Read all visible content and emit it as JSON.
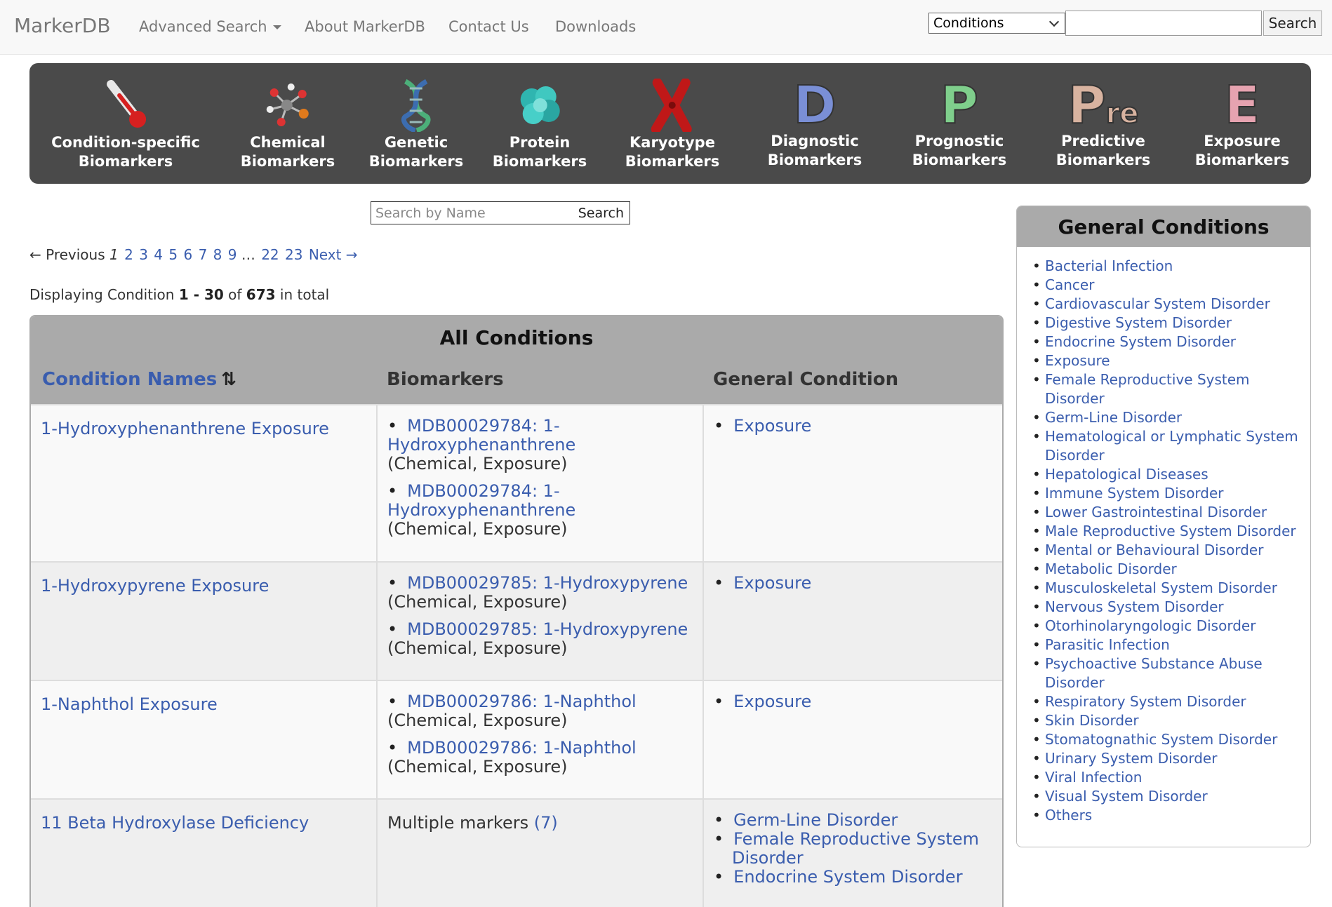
{
  "nav": {
    "brand": "MarkerDB",
    "items": [
      "Advanced Search",
      "About MarkerDB",
      "Contact Us",
      "Downloads"
    ],
    "select_value": "Conditions",
    "search_button": "Search"
  },
  "banner": {
    "categories": [
      {
        "line1": "Condition-specific",
        "line2": "Biomarkers",
        "icon": "thermometer-icon"
      },
      {
        "line1": "Chemical",
        "line2": "Biomarkers",
        "icon": "molecule-icon"
      },
      {
        "line1": "Genetic",
        "line2": "Biomarkers",
        "icon": "dna-icon"
      },
      {
        "line1": "Protein",
        "line2": "Biomarkers",
        "icon": "protein-icon"
      },
      {
        "line1": "Karyotype",
        "line2": "Biomarkers",
        "icon": "chromosome-icon"
      },
      {
        "line1": "Diagnostic",
        "line2": "Biomarkers",
        "icon": "letter-d-icon"
      },
      {
        "line1": "Prognostic",
        "line2": "Biomarkers",
        "icon": "letter-p-icon"
      },
      {
        "line1": "Predictive",
        "line2": "Biomarkers",
        "icon": "letter-pre-icon"
      },
      {
        "line1": "Exposure",
        "line2": "Biomarkers",
        "icon": "letter-e-icon"
      }
    ],
    "letters": {
      "d": "D",
      "p": "P",
      "pre_p": "P",
      "pre_re": "re",
      "e": "E"
    },
    "colors": {
      "d": "#7a8fd6",
      "p": "#7fcf8c",
      "pre": "#d8b3a0",
      "e": "#e6a3b0"
    }
  },
  "name_search": {
    "placeholder": "Search by Name",
    "button": "Search"
  },
  "pager": {
    "previous": "← Previous",
    "current": "1",
    "pages": [
      "2",
      "3",
      "4",
      "5",
      "6",
      "7",
      "8",
      "9"
    ],
    "ellipsis": "…",
    "last_pages": [
      "22",
      "23"
    ],
    "next": "Next →"
  },
  "display": {
    "prefix": "Displaying Condition",
    "range": "1 - 30",
    "of": "of",
    "total": "673",
    "suffix": "in total"
  },
  "table": {
    "title": "All Conditions",
    "headers": {
      "names": "Condition Names",
      "biomarkers": "Biomarkers",
      "general": "General Condition"
    },
    "rows": [
      {
        "name": "1-Hydroxyphenanthrene Exposure",
        "markers": [
          {
            "link1": "MDB00029784: 1-",
            "link2": "Hydroxyphenanthrene",
            "meta": "(Chemical, Exposure)"
          },
          {
            "link1": "MDB00029784: 1-",
            "link2": "Hydroxyphenanthrene",
            "meta": "(Chemical, Exposure)"
          }
        ],
        "general": [
          "Exposure"
        ]
      },
      {
        "name": "1-Hydroxypyrene Exposure",
        "markers": [
          {
            "link1": "MDB00029785: 1-Hydroxypyrene",
            "meta": "(Chemical, Exposure)"
          },
          {
            "link1": "MDB00029785: 1-Hydroxypyrene",
            "meta": "(Chemical, Exposure)"
          }
        ],
        "general": [
          "Exposure"
        ]
      },
      {
        "name": "1-Naphthol Exposure",
        "markers": [
          {
            "link1": "MDB00029786: 1-Naphthol",
            "meta": "(Chemical, Exposure)"
          },
          {
            "link1": "MDB00029786: 1-Naphthol",
            "meta": "(Chemical, Exposure)"
          }
        ],
        "general": [
          "Exposure"
        ]
      },
      {
        "name": "11 Beta Hydroxylase Deficiency",
        "multiple_text": "Multiple markers",
        "multiple_count": "(7)",
        "general": [
          "Germ-Line Disorder",
          "Female Reproductive System Disorder",
          "Endocrine System Disorder"
        ]
      }
    ]
  },
  "sidebar": {
    "title": "General Conditions",
    "items": [
      "Bacterial Infection",
      "Cancer",
      "Cardiovascular System Disorder",
      "Digestive System Disorder",
      "Endocrine System Disorder",
      "Exposure",
      "Female Reproductive System Disorder",
      "Germ-Line Disorder",
      "Hematological or Lymphatic System Disorder",
      "Hepatological Diseases",
      "Immune System Disorder",
      "Lower Gastrointestinal Disorder",
      "Male Reproductive System Disorder",
      "Mental or Behavioural Disorder",
      "Metabolic Disorder",
      "Musculoskeletal System Disorder",
      "Nervous System Disorder",
      "Otorhinolaryngologic Disorder",
      "Parasitic Infection",
      "Psychoactive Substance Abuse Disorder",
      "Respiratory System Disorder",
      "Skin Disorder",
      "Stomatognathic System Disorder",
      "Urinary System Disorder",
      "Viral Infection",
      "Visual System Disorder",
      "Others"
    ]
  }
}
